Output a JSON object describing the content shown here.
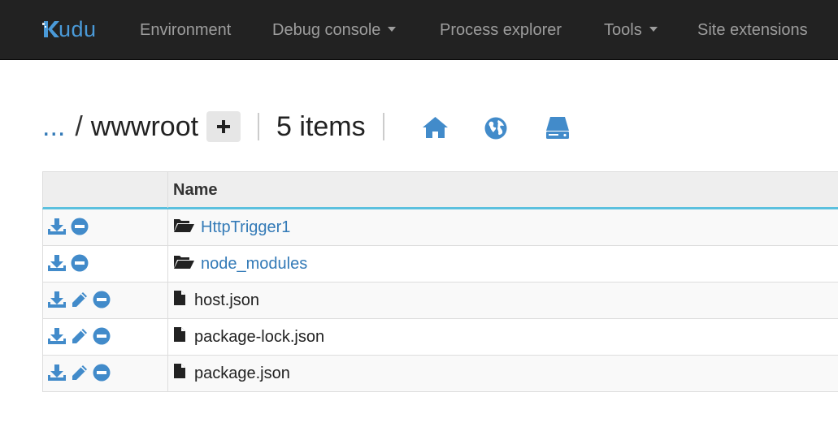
{
  "brand": {
    "text": "udu",
    "logo_icon": "kudu-logo-icon",
    "color": "#4a9ad8"
  },
  "nav": {
    "environment": "Environment",
    "debug_console": "Debug console",
    "process_explorer": "Process explorer",
    "tools": "Tools",
    "site_extensions": "Site extensions"
  },
  "path": {
    "ellipsis": "...",
    "separator": "/",
    "current": "wwwroot",
    "add_icon": "plus-icon",
    "item_count": "5 items",
    "tools": [
      "home-icon",
      "globe-icon",
      "drive-icon"
    ]
  },
  "table": {
    "header_name": "Name",
    "rows": [
      {
        "type": "folder",
        "name": "HttpTrigger1",
        "actions": [
          "download-icon",
          "delete-icon"
        ]
      },
      {
        "type": "folder",
        "name": "node_modules",
        "actions": [
          "download-icon",
          "delete-icon"
        ]
      },
      {
        "type": "file",
        "name": "host.json",
        "actions": [
          "download-icon",
          "edit-icon",
          "delete-icon"
        ]
      },
      {
        "type": "file",
        "name": "package-lock.json",
        "actions": [
          "download-icon",
          "edit-icon",
          "delete-icon"
        ]
      },
      {
        "type": "file",
        "name": "package.json",
        "actions": [
          "download-icon",
          "edit-icon",
          "delete-icon"
        ]
      }
    ]
  },
  "colors": {
    "navbar": "#222222",
    "link": "#337ab7",
    "icon_blue": "#428bca",
    "header_border": "#5bc0de"
  }
}
